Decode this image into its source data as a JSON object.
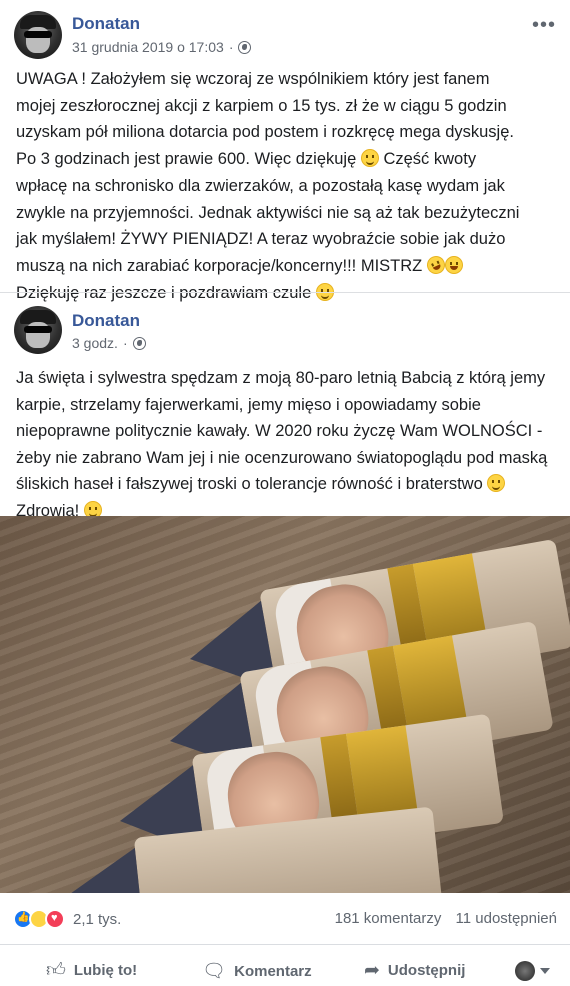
{
  "post": {
    "author": "Donatan",
    "timestamp": "31 grudnia 2019 o 17:03",
    "separator": "·",
    "text_lines": [
      "UWAGA ! Założyłem się wczoraj ze wspólnikiem który jest fanem",
      "mojej zeszłorocznej akcji z karpiem o 15 tys. zł że w ciągu 5 godzin",
      "uzyskam pół miliona dotarcia pod postem i rozkręcę mega dyskusję.",
      "Po 3 godzinach jest prawie 600. Więc dziękuję",
      "Część kwoty",
      "wpłacę na schronisko dla zwierzaków, a pozostałą kasę wydam jak",
      "zwykle na przyjemności. Jednak aktywiści nie są aż tak bezużyteczni",
      "jak myślałem! ŻYWY PIENIĄDZ! A teraz wyobraźcie sobie jak dużo",
      "muszą na nich zarabiać korporacje/koncerny!!! MISTRZ",
      "Dziękuję raz jeszcze i pozdrawiam czule"
    ]
  },
  "shared_post": {
    "author": "Donatan",
    "timestamp": "3 godz.",
    "separator": "·",
    "text_lines": [
      "Ja święta i sylwestra spędzam z moją 80-paro letnią Babcią z którą jemy",
      "karpie, strzelamy fajerwerkami, jemy mięso i opowiadamy sobie",
      "niepoprawne politycznie kawały. W 2020 roku życzę Wam WOLNOŚCI -",
      "żeby nie zabrano Wam jej i nie ocenzurowano światopoglądu pod maską",
      "śliskich haseł i fałszywej troski o tolerancje równość i braterstwo",
      "Zdrowia!"
    ]
  },
  "stats": {
    "reaction_count": "2,1 tys.",
    "comments": "181 komentarzy",
    "shares": "11 udostępnień"
  },
  "actions": {
    "like": "Lubię to!",
    "comment": "Komentarz",
    "share": "Udostępnij"
  },
  "icons": {
    "more": "more-dots-icon",
    "privacy": "globe-icon",
    "like": "thumbs-up-icon",
    "comment": "speech-bubble-icon",
    "share": "share-arrow-icon"
  },
  "colors": {
    "author_link": "#385898",
    "meta_text": "#616770",
    "like_blue": "#1877f2",
    "love_red": "#f33e58"
  }
}
